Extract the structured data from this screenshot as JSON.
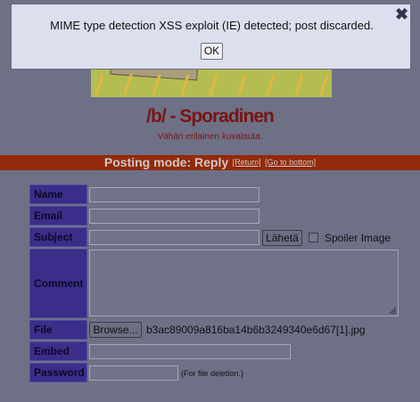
{
  "board": {
    "title": "/b/ - Sporadinen",
    "subtitle": "Vähän erilainen kuvalauta."
  },
  "posting_mode": {
    "label": "Posting mode: Reply",
    "return_link": "[Return]",
    "bottom_link": "[Go to bottom]"
  },
  "form": {
    "name_label": "Name",
    "email_label": "Email",
    "subject_label": "Subject",
    "submit_label": "Lähetä",
    "spoiler_label": "Spoiler Image",
    "comment_label": "Comment",
    "file_label": "File",
    "browse_label": "Browse...",
    "file_name": "b3ac89009a816ba14b6b3249340e6d67[1].jpg",
    "embed_label": "Embed",
    "password_label": "Password",
    "password_hint": "(For file deletion.)"
  },
  "dialog": {
    "message": "MIME type detection XSS exploit (IE) detected; post discarded.",
    "ok_label": "OK",
    "close_glyph": "✖"
  },
  "colors": {
    "dimmed_background": "#6e7186",
    "board_title": "#7a1414",
    "mode_bar": "#922a0b",
    "label_cell": "#3b2d8a",
    "dialog_background": "#dcdfee"
  }
}
